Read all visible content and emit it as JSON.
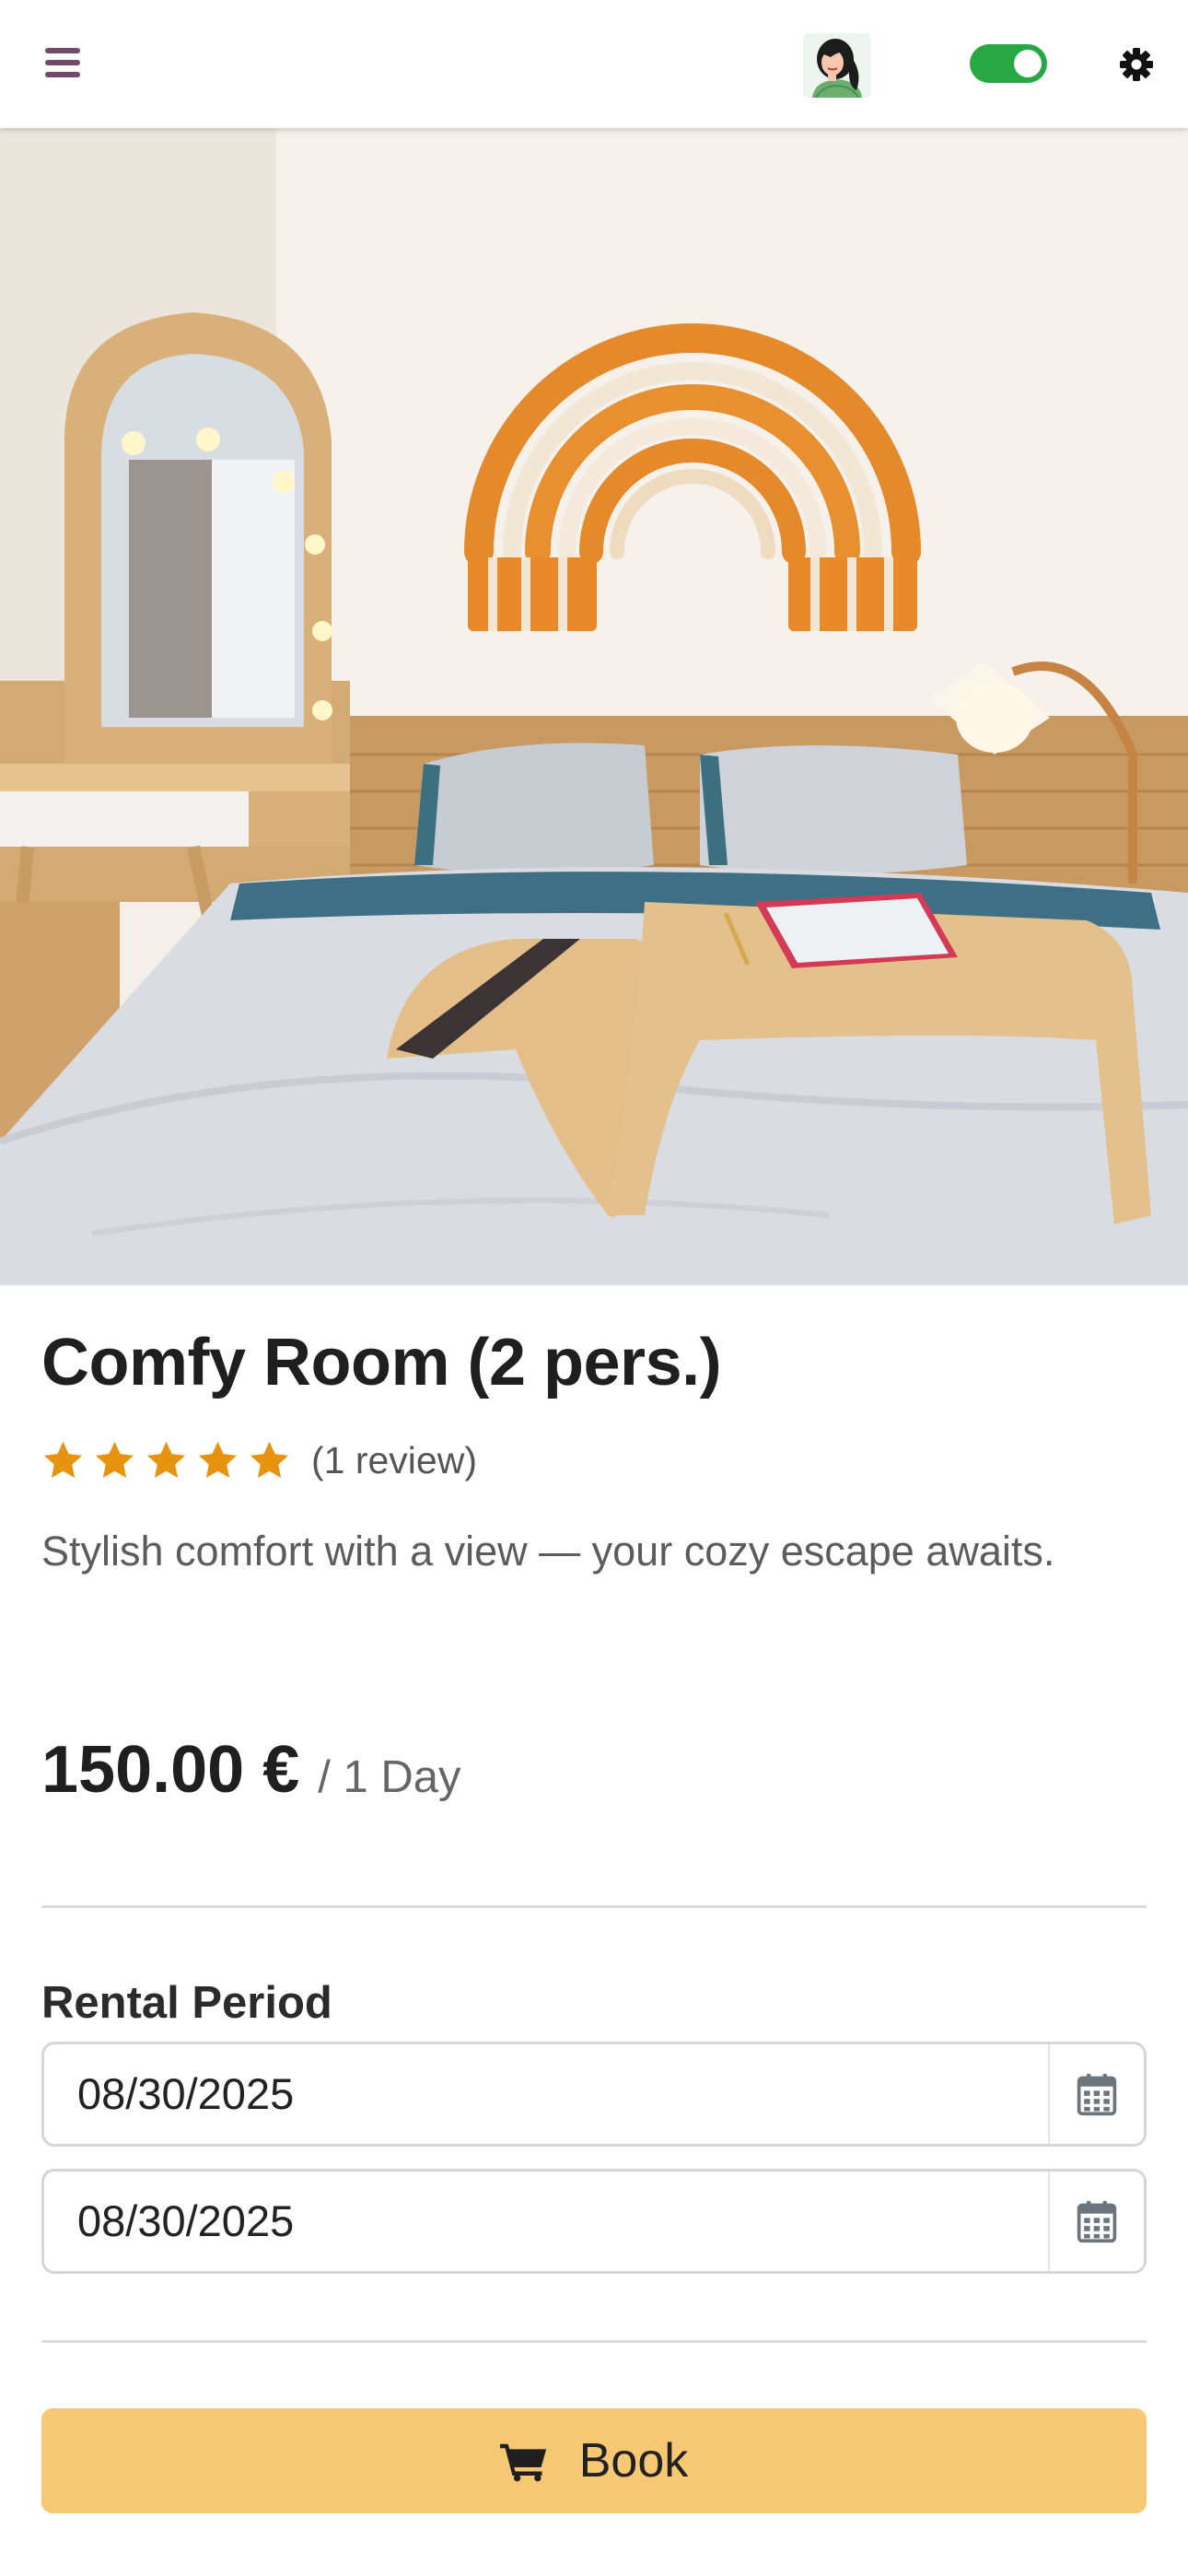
{
  "header": {
    "menu_icon": "hamburger-icon",
    "avatar_icon": "user-avatar",
    "toggle_state": "on",
    "settings_icon": "gear-icon"
  },
  "product": {
    "title": "Comfy Room (2 pers.)",
    "rating_stars": 5,
    "review_count": "(1 review)",
    "description": "Stylish comfort with a view — your cozy escape awaits.",
    "price": "150.00 €",
    "price_unit": "/ 1 Day"
  },
  "rental": {
    "label": "Rental Period",
    "start_date": "08/30/2025",
    "end_date": "08/30/2025",
    "calendar_icon": "calendar-icon"
  },
  "book": {
    "label": "Book",
    "icon": "cart-icon"
  },
  "colors": {
    "brand": "#714B67",
    "toggle_on": "#28a745",
    "star": "#e8930f",
    "book_button": "#f7c873"
  }
}
